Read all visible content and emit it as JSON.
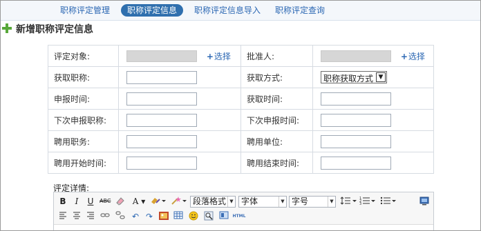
{
  "tabs": [
    {
      "label": "职称评定管理",
      "active": false
    },
    {
      "label": "职称评定信息",
      "active": true
    },
    {
      "label": "职称评定信息导入",
      "active": false
    },
    {
      "label": "职称评定查询",
      "active": false
    }
  ],
  "page": {
    "title": "新增职称评定信息"
  },
  "form": {
    "eval_target_label": "评定对象:",
    "choose_label": "选择",
    "approver_label": "批准人:",
    "obtained_title_label": "获取职称:",
    "obtain_method_label": "获取方式:",
    "obtain_method_value": "职称获取方式",
    "apply_time_label": "申报时间:",
    "obtain_time_label": "获取时间:",
    "next_apply_title_label": "下次申报职称:",
    "next_apply_time_label": "下次申报时间:",
    "hire_position_label": "聘用职务:",
    "hire_unit_label": "聘用单位:",
    "hire_start_label": "聘用开始时间:",
    "hire_end_label": "聘用结束时间:",
    "detail_label": "评定详情:"
  },
  "editor": {
    "paragraph_format": "段落格式",
    "font_family": "字体",
    "font_size": "字号",
    "html_label": "HTML"
  },
  "colors": {
    "accent": "#2f6fae",
    "link": "#2b67b3",
    "plus_icon": "#58a83a"
  }
}
